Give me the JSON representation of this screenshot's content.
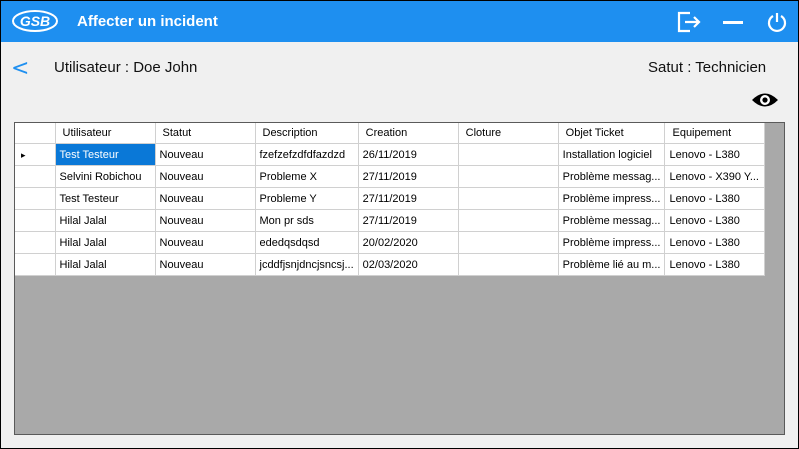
{
  "titlebar": {
    "logo_text": "GSB",
    "title": "Affecter un incident",
    "icons": [
      "logout-icon",
      "minimize-icon",
      "power-icon"
    ]
  },
  "header": {
    "back_label": "<",
    "user_label": "Utilisateur : Doe John",
    "status_label": "Satut : Technicien",
    "view_icon": "eye-icon"
  },
  "grid": {
    "columns": [
      "Utilisateur",
      "Statut",
      "Description",
      "Creation",
      "Cloture",
      "Objet Ticket",
      "Equipement"
    ],
    "rows": [
      [
        "Test Testeur",
        "Nouveau",
        "fzefzefzdfdfazdzd",
        "26/11/2019",
        "",
        "Installation logiciel",
        "Lenovo - L380"
      ],
      [
        "Selvini Robichou",
        "Nouveau",
        "Probleme X",
        "27/11/2019",
        "",
        "Problème messag...",
        "Lenovo - X390 Y..."
      ],
      [
        "Test Testeur",
        "Nouveau",
        "Probleme Y",
        "27/11/2019",
        "",
        "Problème impress...",
        "Lenovo - L380"
      ],
      [
        "Hilal Jalal",
        "Nouveau",
        "Mon pr sds",
        "27/11/2019",
        "",
        "Problème messag...",
        "Lenovo - L380"
      ],
      [
        "Hilal Jalal",
        "Nouveau",
        "ededqsdqsd",
        "20/02/2020",
        "",
        "Problème impress...",
        "Lenovo - L380"
      ],
      [
        "Hilal Jalal",
        "Nouveau",
        "jcddfjsnjdncjsncsj...",
        "02/03/2020",
        "",
        "Problème lié au m...",
        "Lenovo - L380"
      ]
    ],
    "current_row_marker": "▸"
  },
  "colors": {
    "accent": "#1e8ff0",
    "selection": "#0a78d7",
    "grid_background": "#a9a9a9"
  }
}
